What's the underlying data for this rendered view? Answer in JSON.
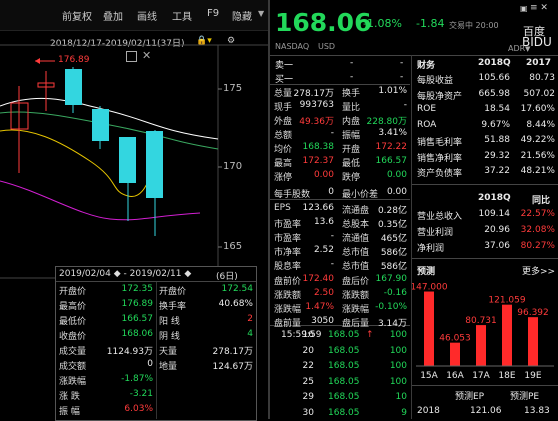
{
  "toolbar": {
    "items": [
      "前复权",
      "叠加",
      "画线",
      "工具",
      "F9",
      "隐藏"
    ]
  },
  "chart": {
    "date_range": "2018/12/17-2019/02/11(37日)",
    "high_label": "176.89",
    "price_ticks": [
      "175",
      "170",
      "165"
    ]
  },
  "infobox": {
    "range": "2019/02/04 ◆ - 2019/02/11 ◆",
    "days": "(6日)",
    "rows": [
      {
        "l1": "开盘价",
        "v1": "172.35",
        "l2": "开盘价",
        "v2": "172.54",
        "c1": "green",
        "c2": "green"
      },
      {
        "l1": "最高价",
        "v1": "176.89",
        "l2": "换手率",
        "v2": "40.68%",
        "c1": "green",
        "c2": "white"
      },
      {
        "l1": "最低价",
        "v1": "166.57",
        "l2": "阳 线",
        "v2": "2",
        "c1": "green",
        "c2": "red"
      },
      {
        "l1": "收盘价",
        "v1": "168.06",
        "l2": "阴 线",
        "v2": "4",
        "c1": "green",
        "c2": "green"
      },
      {
        "l1": "成交量",
        "v1": "1124.93万",
        "l2": "天量",
        "v2": "278.17万",
        "c1": "white",
        "c2": "white"
      },
      {
        "l1": "成交额",
        "v1": "0",
        "l2": "地量",
        "v2": "124.67万",
        "c1": "white",
        "c2": "white"
      },
      {
        "l1": "涨跌幅",
        "v1": "-1.87%",
        "l2": "",
        "v2": "",
        "c1": "green",
        "c2": "white"
      },
      {
        "l1": "涨 跌",
        "v1": "-3.21",
        "l2": "",
        "v2": "",
        "c1": "green",
        "c2": "white"
      },
      {
        "l1": "振 幅",
        "v1": "6.03%",
        "l2": "",
        "v2": "",
        "c1": "red",
        "c2": "white"
      }
    ]
  },
  "quote": {
    "price": "168.06",
    "change": "-1.08%",
    "change_abs": "-1.84",
    "status": "交易中 20:00",
    "en_name": "百度",
    "code": "BIDU",
    "market": "NASDAQ",
    "currency": "USD",
    "adr": "ADR",
    "sell_label": "卖一",
    "buy_label": "买一",
    "dash": "-"
  },
  "stats": [
    {
      "l1": "总量",
      "v1": "278.17万",
      "l2": "换手",
      "v2": "1.01%",
      "c1": "white",
      "c2": "white"
    },
    {
      "l1": "现手",
      "v1": "993763",
      "l2": "量比",
      "v2": "-",
      "c1": "white",
      "c2": "white"
    },
    {
      "l1": "外盘",
      "v1": "49.36万",
      "l2": "内盘",
      "v2": "228.80万",
      "c1": "red",
      "c2": "green"
    },
    {
      "l1": "总额",
      "v1": "-",
      "l2": "振幅",
      "v2": "3.41%",
      "c1": "white",
      "c2": "white"
    },
    {
      "l1": "均价",
      "v1": "168.38",
      "l2": "开盘",
      "v2": "172.22",
      "c1": "green",
      "c2": "red"
    },
    {
      "l1": "最高",
      "v1": "172.37",
      "l2": "最低",
      "v2": "166.57",
      "c1": "red",
      "c2": "green"
    },
    {
      "l1": "涨停",
      "v1": "0.00",
      "l2": "跌停",
      "v2": "0.00",
      "c1": "red",
      "c2": "green"
    },
    {
      "l1": "每手股数",
      "v1": "0",
      "l2": "最小价差",
      "v2": "0.00",
      "c1": "white",
      "c2": "white"
    },
    {
      "l1": "EPS",
      "v1": "123.66",
      "l2": "流通盘",
      "v2": "0.28亿",
      "c1": "white",
      "c2": "white"
    },
    {
      "l1": "市盈率",
      "v1": "13.6",
      "l2": "总股本",
      "v2": "0.35亿",
      "c1": "white",
      "c2": "white"
    },
    {
      "l1": "市盈率",
      "v1": "-",
      "l2": "流通值",
      "v2": "465亿",
      "c1": "white",
      "c2": "white"
    },
    {
      "l1": "市净率",
      "v1": "2.52",
      "l2": "总市值",
      "v2": "586亿",
      "c1": "white",
      "c2": "white"
    },
    {
      "l1": "股息率",
      "v1": "-",
      "l2": "总市值",
      "v2": "586亿",
      "c1": "white",
      "c2": "white"
    },
    {
      "l1": "盘前价",
      "v1": "172.40",
      "l2": "盘后价",
      "v2": "167.90",
      "c1": "red",
      "c2": "green"
    },
    {
      "l1": "涨跌额",
      "v1": "2.50",
      "l2": "涨跌额",
      "v2": "-0.16",
      "c1": "red",
      "c2": "green"
    },
    {
      "l1": "涨跌幅",
      "v1": "1.47%",
      "l2": "涨跌幅",
      "v2": "-0.10%",
      "c1": "red",
      "c2": "green"
    },
    {
      "l1": "盘前量",
      "v1": "3050",
      "l2": "盘后量",
      "v2": "3.14万",
      "c1": "white",
      "c2": "white"
    }
  ],
  "fin": {
    "title": "财务",
    "col1": "2018Q",
    "col2": "2017",
    "rows": [
      {
        "l": "每股收益",
        "v1": "105.66",
        "v2": "80.73"
      },
      {
        "l": "每股净资产",
        "v1": "665.98",
        "v2": "507.02"
      },
      {
        "l": "ROE",
        "v1": "18.54",
        "v2": "17.60%"
      },
      {
        "l": "ROA",
        "v1": "9.67%",
        "v2": "8.44%"
      },
      {
        "l": "销售毛利率",
        "v1": "51.88",
        "v2": "49.22%"
      },
      {
        "l": "销售净利率",
        "v1": "29.32",
        "v2": "21.56%"
      },
      {
        "l": "资产负债率",
        "v1": "37.22",
        "v2": "48.21%"
      }
    ],
    "col3": "2018Q",
    "col4": "同比",
    "rows2": [
      {
        "l": "营业总收入",
        "v1": "109.14",
        "v2": "22.57%"
      },
      {
        "l": "营业利润",
        "v1": "20.96",
        "v2": "32.08%"
      },
      {
        "l": "净利润",
        "v1": "37.06",
        "v2": "80.27%"
      }
    ]
  },
  "forecast": {
    "title": "预测",
    "more": "更多>>",
    "bars": [
      {
        "label": "15A",
        "value": 147.0,
        "text": "147.000"
      },
      {
        "label": "16A",
        "value": 46.053,
        "text": "46.053"
      },
      {
        "label": "17A",
        "value": 80.731,
        "text": "80.731"
      },
      {
        "label": "18E",
        "value": 121.059,
        "text": "121.059"
      },
      {
        "label": "19E",
        "value": 96.392,
        "text": "96.392"
      }
    ],
    "pe_title": "预测EP",
    "pe2_title": "预测PE",
    "year": "2018",
    "pe_v1": "121.06",
    "pe_v2": "13.83"
  },
  "ticks": [
    {
      "time": "15:59:59",
      "num": "16",
      "price": "168.05",
      "vol": "100"
    },
    {
      "time": "",
      "num": "20",
      "price": "168.05",
      "vol": "100"
    },
    {
      "time": "",
      "num": "22",
      "price": "168.05",
      "vol": "100"
    },
    {
      "time": "",
      "num": "25",
      "price": "168.05",
      "vol": "100"
    },
    {
      "time": "",
      "num": "29",
      "price": "168.05",
      "vol": "10"
    },
    {
      "time": "",
      "num": "30",
      "price": "168.05",
      "vol": "9"
    }
  ]
}
